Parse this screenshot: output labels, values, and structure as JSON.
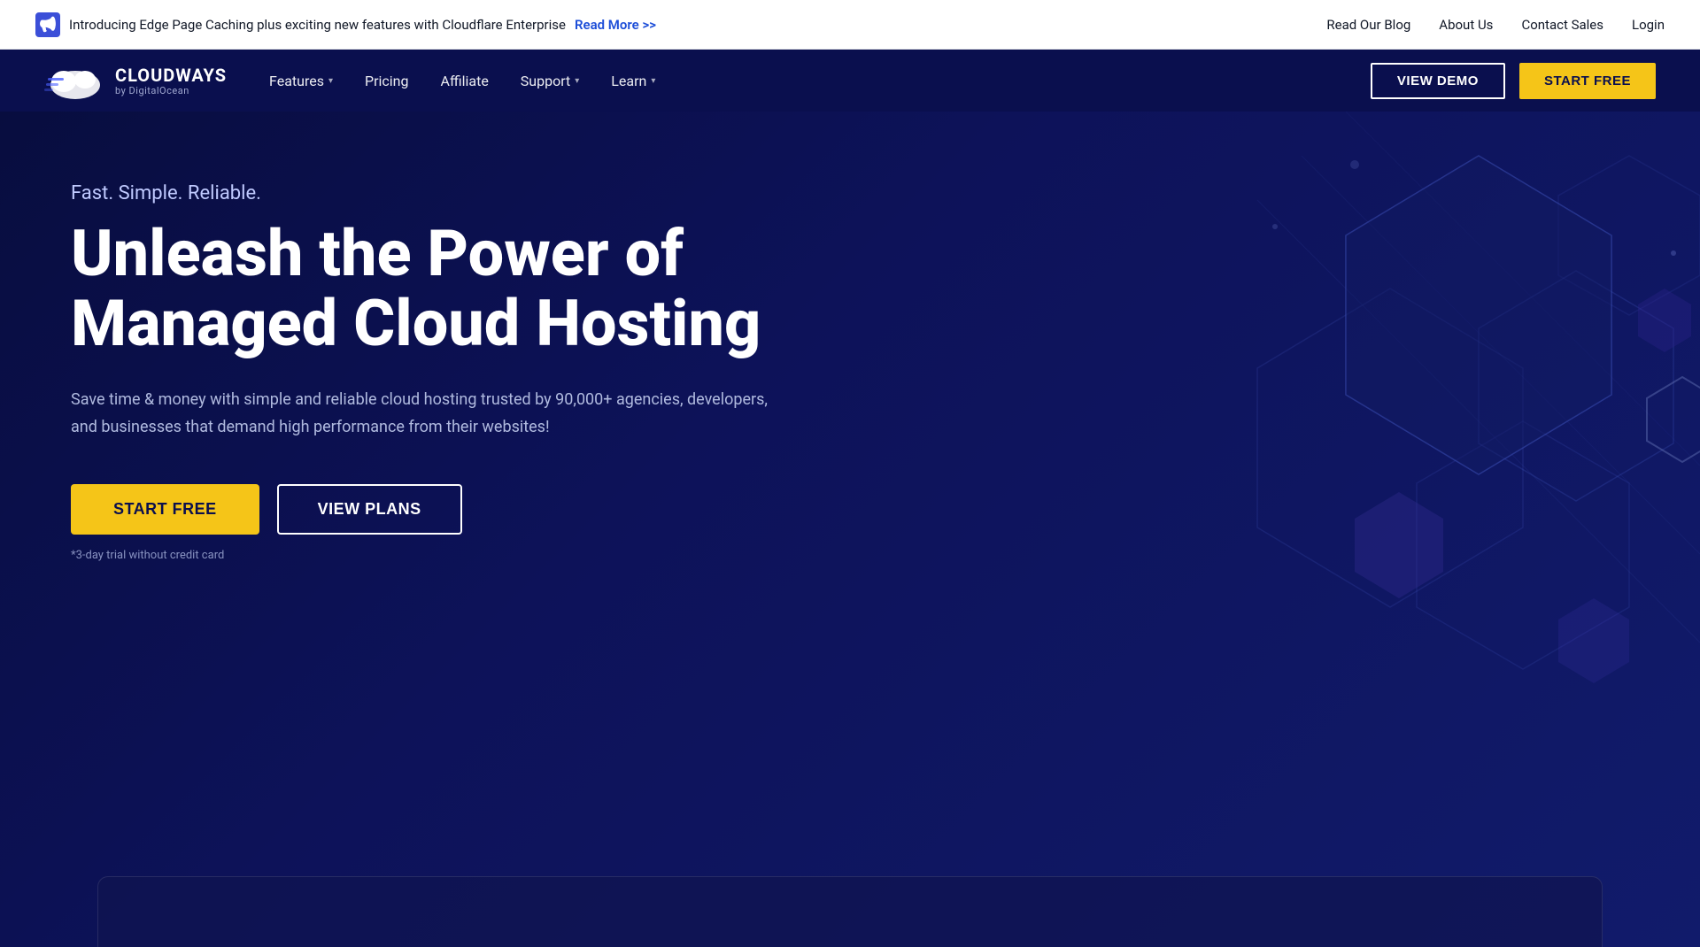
{
  "topbar": {
    "announcement": "Introducing Edge Page Caching plus exciting new features with Cloudflare Enterprise",
    "read_more_label": "Read More >>",
    "links": [
      {
        "label": "Read Our Blog",
        "name": "read-our-blog-link"
      },
      {
        "label": "About Us",
        "name": "about-us-link"
      },
      {
        "label": "Contact Sales",
        "name": "contact-sales-link"
      },
      {
        "label": "Login",
        "name": "login-link"
      }
    ]
  },
  "nav": {
    "logo_main": "CLOUDWAYS",
    "logo_sub": "by DigitalOcean",
    "links": [
      {
        "label": "Features",
        "has_dropdown": true,
        "name": "features-nav"
      },
      {
        "label": "Pricing",
        "has_dropdown": false,
        "name": "pricing-nav"
      },
      {
        "label": "Affiliate",
        "has_dropdown": false,
        "name": "affiliate-nav"
      },
      {
        "label": "Support",
        "has_dropdown": true,
        "name": "support-nav"
      },
      {
        "label": "Learn",
        "has_dropdown": true,
        "name": "learn-nav"
      }
    ],
    "view_demo_label": "VIEW DEMO",
    "start_free_label": "START FREE"
  },
  "hero": {
    "tagline": "Fast. Simple. Reliable.",
    "title": "Unleash the Power of Managed Cloud Hosting",
    "description": "Save time & money with simple and reliable cloud hosting trusted by 90,000+ agencies, developers, and businesses that demand high performance from their websites!",
    "start_free_label": "START FREE",
    "view_plans_label": "VIEW PLANS",
    "trial_text": "*3-day trial without credit card"
  }
}
